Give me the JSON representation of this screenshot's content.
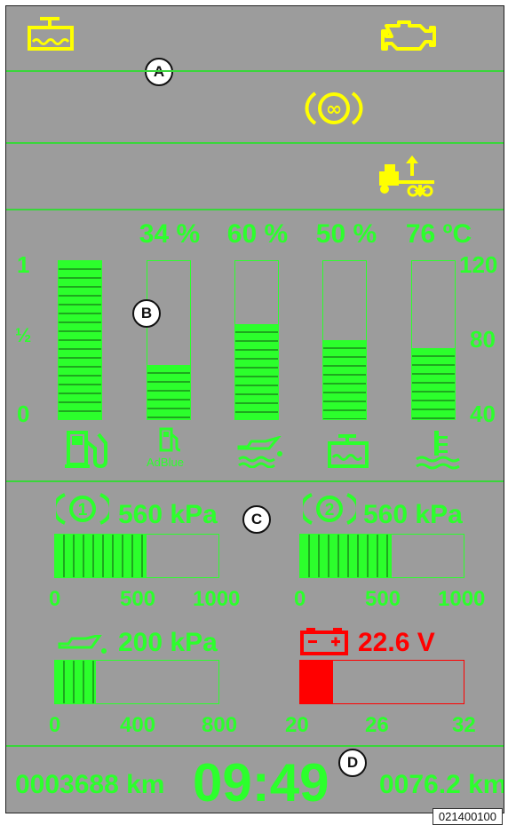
{
  "callouts": {
    "a": "A",
    "b": "B",
    "c": "C",
    "d": "D"
  },
  "section_a": {
    "icons": [
      "coolant-level-warning-icon",
      "engine-warning-icon",
      "parking-brake-icon",
      "axle-lift-icon"
    ]
  },
  "section_b": {
    "left_scale": {
      "full": "1",
      "half": "½",
      "empty": "0"
    },
    "right_scale": {
      "top": "120",
      "mid": "80",
      "bottom": "40"
    },
    "gauges": [
      {
        "name": "fuel",
        "label": "",
        "fill": 1.0
      },
      {
        "name": "adblue",
        "label": "34 %",
        "fill": 0.34,
        "icon_text": "AdBlue"
      },
      {
        "name": "hydraulic-oil",
        "label": "60 %",
        "fill": 0.6
      },
      {
        "name": "coolant",
        "label": "50 %",
        "fill": 0.5
      },
      {
        "name": "coolant-temperature",
        "label": "76 ºC",
        "fill": 0.45
      }
    ]
  },
  "section_c": {
    "brake1": {
      "circuit": "1",
      "value": "560 kPa",
      "fill": 0.56,
      "ticks": [
        "0",
        "500",
        "1000"
      ]
    },
    "brake2": {
      "circuit": "2",
      "value": "560 kPa",
      "fill": 0.56,
      "ticks": [
        "0",
        "500",
        "1000"
      ]
    },
    "oil_pressure": {
      "value": "200 kPa",
      "fill": 0.25,
      "ticks": [
        "0",
        "400",
        "800"
      ]
    },
    "battery": {
      "value": "22.6 V",
      "fill": 0.2,
      "ticks": [
        "20",
        "26",
        "32"
      ]
    }
  },
  "section_d": {
    "odometer": "0003688 km",
    "time": "09:49",
    "trip": "0076.2 km"
  },
  "figure_code": "021400100",
  "colors": {
    "green": "#2cff2c",
    "yellow": "#ffff00",
    "red": "#ff0000",
    "background": "#9c9c9c"
  }
}
